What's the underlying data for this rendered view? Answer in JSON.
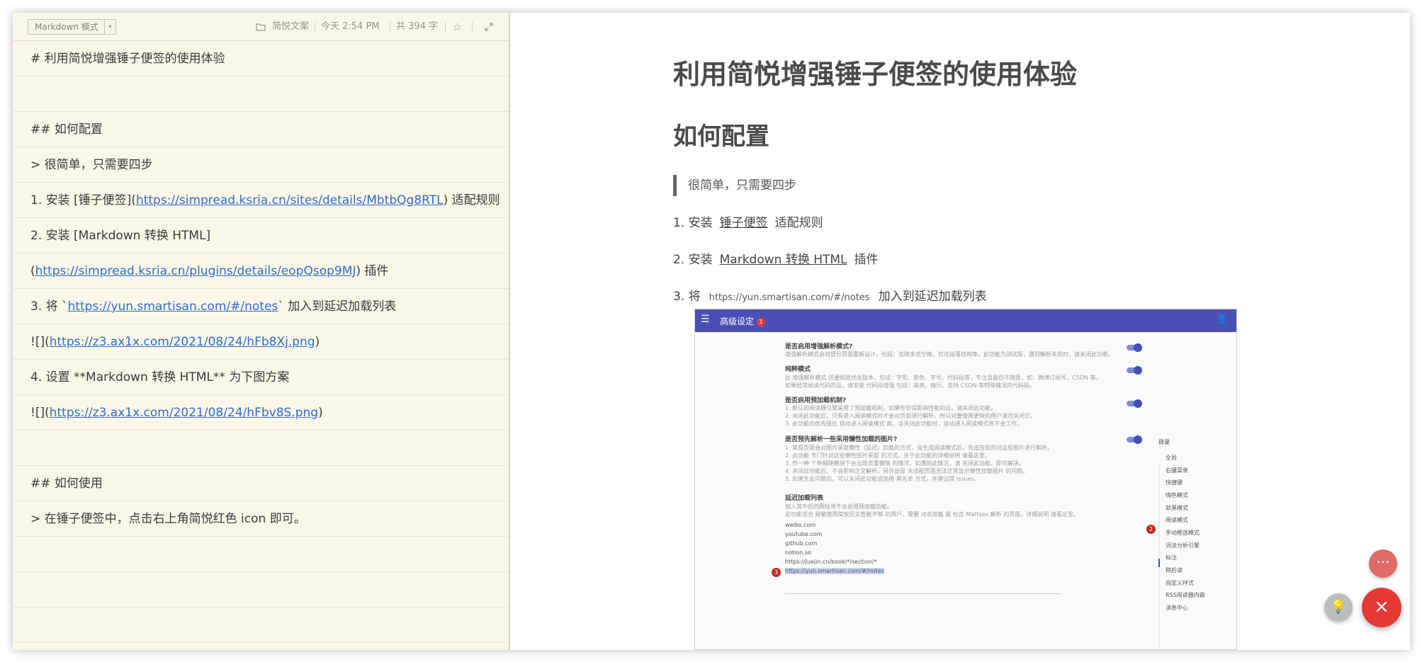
{
  "editor": {
    "mode_label": "Markdown 模式",
    "toolbar": {
      "folder": "简悦文案",
      "time": "今天 2:54 PM",
      "count": "共 394 字"
    },
    "lines": {
      "l1": "# 利用简悦增强锤子便签的使用体验",
      "l3": "## 如何配置",
      "l4": "> 很简单，只需要四步",
      "l5_prefix": "1. 安装 [锤子便签](",
      "l5_link": "https://simpread.ksria.cn/sites/details/MbtbQg8RTL",
      "l5_suffix": ") 适配规则",
      "l6": "2. 安装 [Markdown 转换 HTML]",
      "l7_prefix": "(",
      "l7_link": "https://simpread.ksria.cn/plugins/details/eopQsop9MJ",
      "l7_suffix": ") 插件",
      "l8_prefix": "3. 将 `",
      "l8_link": "https://yun.smartisan.com/#/notes",
      "l8_suffix": "` 加入到延迟加载列表",
      "l9_prefix": "![](",
      "l9_link": "https://z3.ax1x.com/2021/08/24/hFb8Xj.png",
      "l9_suffix": ")",
      "l10": "4. 设置 **Markdown 转换 HTML** 为下图方案",
      "l11_prefix": "![](",
      "l11_link": "https://z3.ax1x.com/2021/08/24/hFbv8S.png",
      "l11_suffix": ")",
      "l13": "## 如何使用",
      "l14": "> 在锤子便签中，点击右上角简悦红色 icon 即可。"
    }
  },
  "preview": {
    "h1": "利用简悦增强锤子便签的使用体验",
    "h2": "如何配置",
    "quote": "很简单，只需要四步",
    "step1": {
      "num": "1. 安装",
      "link": "锤子便签",
      "rest": "适配规则"
    },
    "step2": {
      "num": "2. 安装",
      "link": "Markdown 转换 HTML",
      "rest": "插件"
    },
    "step3": {
      "num": "3. 将",
      "code": "https://yun.smartisan.com/#/notes",
      "rest": "加入到延迟加载列表"
    },
    "screenshot": {
      "title": "高级设定",
      "badge": "1",
      "s1_title": "是否启用增强解析模式?",
      "s1_desc": "增强解析模式会对部分页面重新设计，包括：去除多余空格，优化段落结构等。此功能为测试版，遇到解析失败时，请关闭此功能。",
      "s2_title": "纯粹模式",
      "s2_desc1": "比 增强解析模式 还要彻底优化版本，包括：字形、颜色、字号、代码段等，专注且最后不随意，如：微博订阅号、CSDN 等。",
      "s2_desc2": "如果经常阅读代码的话，请安装 代码段增强 包括：高亮、换行、支持 CSDN 等特殊情况的代码段。",
      "s3_title": "是否启用预加载机制?",
      "s3_d1": "1. 默认的阅读器引擎采用了预加载机制，如果你觉得影响性能的话，请关闭此功能。",
      "s3_d2": "2. 关闭此功能后，只有进入阅读模式时才会对页面进行解析，所以对要使用更快的用户请勿关闭它。",
      "s3_d3": "3. 此功能的优先级比 自动进入阅读模式 高，当关闭此功能时，自动进入阅读模式将不会工作。",
      "s4_title": "是否预先解析一些采用懒性加载的图片?",
      "s4_d1": "1. 某些页面会对图片采取懒性（延迟）加载的方式，当生成阅读模式后，先出在现的对这些图片进行解析。",
      "s4_d2": "2. 此功能 专门针对这些懒性图片采取 的方式，关于此功能的详细说明 请看这里。",
      "s4_d3": "3. 作一种 个新幅随模块下会出现去重懒惰 的情况，如遇到此情况，请 关闭此功能。即可解决。",
      "s4_d4": "4. 关闭此功能后，不会影响正文解析，另外出现 未适配页面无法正常显示懒性加载图片 的问题。",
      "s4_d5": "5. 如果生此问题后，可以关闭此功能或使用 黑名单 方式，并建议提 Issues。",
      "s5_title": "延迟加载列表",
      "s5_d1": "加入其中后的网址将不会启用预加载功能。",
      "s5_d2": "此功能适合 频繁使用简悦但又性能不够 的用户，需要 动态加载 或 包含 Mathjax 解析 的页面，详细说明 请看这里。",
      "list": [
        "weibo.com",
        "youtube.com",
        "github.com",
        "notion.so",
        "https://juejin.cn/book/*/section/*"
      ],
      "highlight": "https://yun.smartisan.com/#/notes",
      "toc_title": "目录",
      "toc": [
        "全局",
        "右键菜单",
        "快捷键",
        "嗨色模式",
        "就黑模式",
        "阅读模式",
        "手动框选模式",
        "词法分析引擎",
        "标注",
        "稍后读",
        "自定义样式",
        "RSS阅读器内嵌",
        "消息中心"
      ],
      "marker2": "2",
      "marker3": "3"
    }
  },
  "fabs": {
    "more": "···",
    "light": "💡",
    "close": "×"
  }
}
